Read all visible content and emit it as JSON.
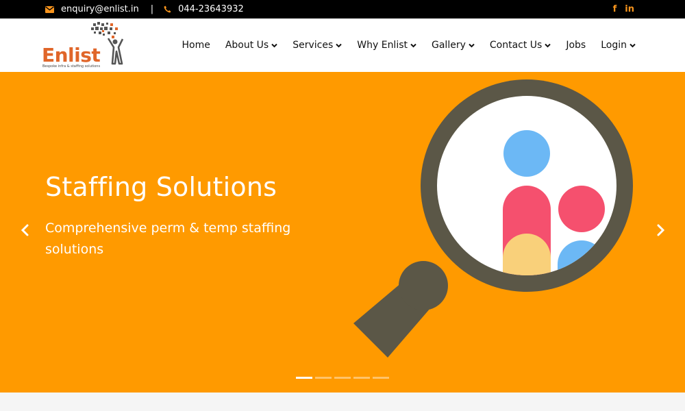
{
  "topbar": {
    "email": "enquiry@enlist.in",
    "separator": "|",
    "phone": "044-23643932",
    "social": {
      "facebook": "f",
      "linkedin": "in"
    }
  },
  "logo": {
    "name": "Enlist",
    "tagline": "Bespoke infra & staffing solutions"
  },
  "nav": [
    {
      "label": "Home",
      "dropdown": false
    },
    {
      "label": "About Us",
      "dropdown": true
    },
    {
      "label": "Services",
      "dropdown": true
    },
    {
      "label": "Why Enlist",
      "dropdown": true
    },
    {
      "label": "Gallery",
      "dropdown": true
    },
    {
      "label": "Contact Us",
      "dropdown": true
    },
    {
      "label": "Jobs",
      "dropdown": false
    },
    {
      "label": "Login",
      "dropdown": true
    }
  ],
  "hero": {
    "title": "Staffing Solutions",
    "subtitle": "Comprehensive perm & temp staffing solutions",
    "slide_count": 5,
    "active_slide": 1
  },
  "colors": {
    "accent": "#f7941d",
    "hero_bg": "#ff9a00",
    "logo_orange": "#e0662a",
    "lens_frame": "#5b5747",
    "person_blue": "#6cb8f5",
    "person_red": "#f5506e",
    "person_yellow": "#f9d07a"
  },
  "icons": {
    "email": "envelope-icon",
    "phone": "phone-icon",
    "prev": "chevron-left-icon",
    "next": "chevron-right-icon",
    "dropdown": "chevron-down-icon"
  }
}
